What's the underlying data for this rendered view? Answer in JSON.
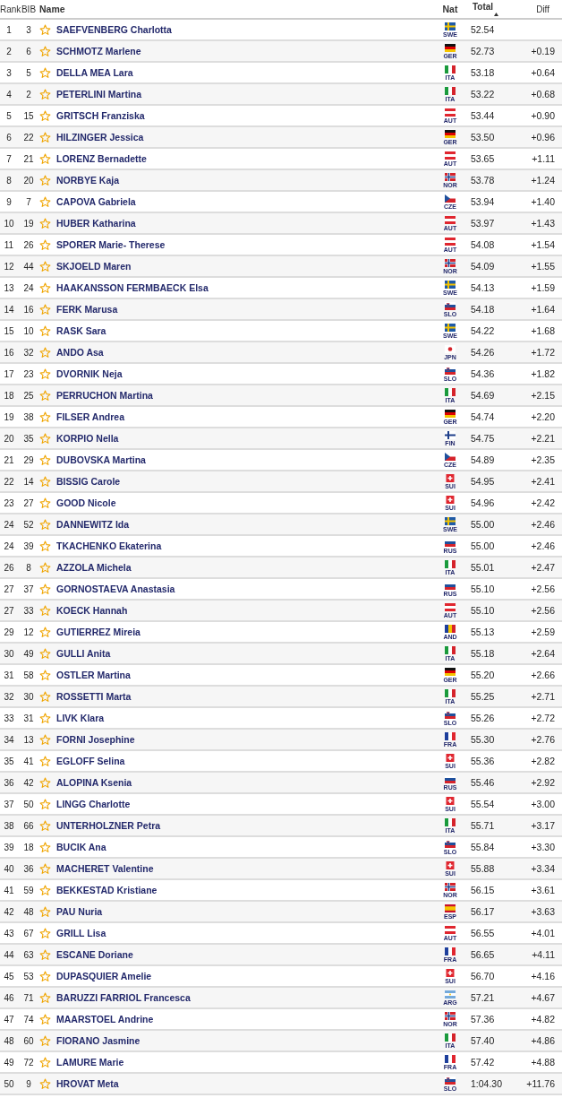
{
  "columns": {
    "rank": "Rank",
    "bib": "BIB",
    "name": "Name",
    "nat": "Nat",
    "total": "Total",
    "diff": "Diff"
  },
  "rows": [
    {
      "rank": "1",
      "bib": "3",
      "name": "SAEFVENBERG Charlotta",
      "kind": "swe",
      "nat": "SWE",
      "total": "52.54"
    },
    {
      "rank": "2",
      "bib": "6",
      "name": "SCHMOTZ Marlene",
      "kind": "ger",
      "nat": "GER",
      "total": "52.73",
      "diff": "+0.19"
    },
    {
      "rank": "3",
      "bib": "5",
      "name": "DELLA MEA Lara",
      "kind": "ita",
      "nat": "ITA",
      "total": "53.18",
      "diff": "+0.64"
    },
    {
      "rank": "4",
      "bib": "2",
      "name": "PETERLINI Martina",
      "kind": "ita",
      "nat": "ITA",
      "total": "53.22",
      "diff": "+0.68"
    },
    {
      "rank": "5",
      "bib": "15",
      "name": "GRITSCH Franziska",
      "kind": "aut",
      "nat": "AUT",
      "total": "53.44",
      "diff": "+0.90"
    },
    {
      "rank": "6",
      "bib": "22",
      "name": "HILZINGER Jessica",
      "kind": "ger",
      "nat": "GER",
      "total": "53.50",
      "diff": "+0.96"
    },
    {
      "rank": "7",
      "bib": "21",
      "name": "LORENZ Bernadette",
      "kind": "aut",
      "nat": "AUT",
      "total": "53.65",
      "diff": "+1.11"
    },
    {
      "rank": "8",
      "bib": "20",
      "name": "NORBYE Kaja",
      "kind": "nor",
      "nat": "NOR",
      "total": "53.78",
      "diff": "+1.24"
    },
    {
      "rank": "9",
      "bib": "7",
      "name": "CAPOVA Gabriela",
      "kind": "cze",
      "nat": "CZE",
      "total": "53.94",
      "diff": "+1.40"
    },
    {
      "rank": "10",
      "bib": "19",
      "name": "HUBER Katharina",
      "kind": "aut",
      "nat": "AUT",
      "total": "53.97",
      "diff": "+1.43"
    },
    {
      "rank": "11",
      "bib": "26",
      "name": "SPORER Marie- Therese",
      "kind": "aut",
      "nat": "AUT",
      "total": "54.08",
      "diff": "+1.54"
    },
    {
      "rank": "12",
      "bib": "44",
      "name": "SKJOELD Maren",
      "kind": "nor",
      "nat": "NOR",
      "total": "54.09",
      "diff": "+1.55"
    },
    {
      "rank": "13",
      "bib": "24",
      "name": "HAAKANSSON FERMBAECK Elsa",
      "kind": "swe",
      "nat": "SWE",
      "total": "54.13",
      "diff": "+1.59"
    },
    {
      "rank": "14",
      "bib": "16",
      "name": "FERK Marusa",
      "kind": "slo",
      "nat": "SLO",
      "total": "54.18",
      "diff": "+1.64"
    },
    {
      "rank": "15",
      "bib": "10",
      "name": "RASK Sara",
      "kind": "swe",
      "nat": "SWE",
      "total": "54.22",
      "diff": "+1.68"
    },
    {
      "rank": "16",
      "bib": "32",
      "name": "ANDO Asa",
      "kind": "jpn",
      "nat": "JPN",
      "total": "54.26",
      "diff": "+1.72"
    },
    {
      "rank": "17",
      "bib": "23",
      "name": "DVORNIK Neja",
      "kind": "slo",
      "nat": "SLO",
      "total": "54.36",
      "diff": "+1.82"
    },
    {
      "rank": "18",
      "bib": "25",
      "name": "PERRUCHON Martina",
      "kind": "ita",
      "nat": "ITA",
      "total": "54.69",
      "diff": "+2.15"
    },
    {
      "rank": "19",
      "bib": "38",
      "name": "FILSER Andrea",
      "kind": "ger",
      "nat": "GER",
      "total": "54.74",
      "diff": "+2.20"
    },
    {
      "rank": "20",
      "bib": "35",
      "name": "KORPIO Nella",
      "kind": "fin",
      "nat": "FIN",
      "total": "54.75",
      "diff": "+2.21"
    },
    {
      "rank": "21",
      "bib": "29",
      "name": "DUBOVSKA Martina",
      "kind": "cze",
      "nat": "CZE",
      "total": "54.89",
      "diff": "+2.35"
    },
    {
      "rank": "22",
      "bib": "14",
      "name": "BISSIG Carole",
      "kind": "sui",
      "nat": "SUI",
      "total": "54.95",
      "diff": "+2.41"
    },
    {
      "rank": "23",
      "bib": "27",
      "name": "GOOD Nicole",
      "kind": "sui",
      "nat": "SUI",
      "total": "54.96",
      "diff": "+2.42"
    },
    {
      "rank": "24",
      "bib": "52",
      "name": "DANNEWITZ Ida",
      "kind": "swe",
      "nat": "SWE",
      "total": "55.00",
      "diff": "+2.46"
    },
    {
      "rank": "24",
      "bib": "39",
      "name": "TKACHENKO Ekaterina",
      "kind": "rus",
      "nat": "RUS",
      "total": "55.00",
      "diff": "+2.46"
    },
    {
      "rank": "26",
      "bib": "8",
      "name": "AZZOLA Michela",
      "kind": "ita",
      "nat": "ITA",
      "total": "55.01",
      "diff": "+2.47"
    },
    {
      "rank": "27",
      "bib": "37",
      "name": "GORNOSTAEVA Anastasia",
      "kind": "rus",
      "nat": "RUS",
      "total": "55.10",
      "diff": "+2.56"
    },
    {
      "rank": "27",
      "bib": "33",
      "name": "KOECK Hannah",
      "kind": "aut",
      "nat": "AUT",
      "total": "55.10",
      "diff": "+2.56"
    },
    {
      "rank": "29",
      "bib": "12",
      "name": "GUTIERREZ Mireia",
      "kind": "and",
      "nat": "AND",
      "total": "55.13",
      "diff": "+2.59"
    },
    {
      "rank": "30",
      "bib": "49",
      "name": "GULLI Anita",
      "kind": "ita",
      "nat": "ITA",
      "total": "55.18",
      "diff": "+2.64"
    },
    {
      "rank": "31",
      "bib": "58",
      "name": "OSTLER Martina",
      "kind": "ger",
      "nat": "GER",
      "total": "55.20",
      "diff": "+2.66"
    },
    {
      "rank": "32",
      "bib": "30",
      "name": "ROSSETTI Marta",
      "kind": "ita",
      "nat": "ITA",
      "total": "55.25",
      "diff": "+2.71"
    },
    {
      "rank": "33",
      "bib": "31",
      "name": "LIVK Klara",
      "kind": "slo",
      "nat": "SLO",
      "total": "55.26",
      "diff": "+2.72"
    },
    {
      "rank": "34",
      "bib": "13",
      "name": "FORNI Josephine",
      "kind": "fra",
      "nat": "FRA",
      "total": "55.30",
      "diff": "+2.76"
    },
    {
      "rank": "35",
      "bib": "41",
      "name": "EGLOFF Selina",
      "kind": "sui",
      "nat": "SUI",
      "total": "55.36",
      "diff": "+2.82"
    },
    {
      "rank": "36",
      "bib": "42",
      "name": "ALOPINA Ksenia",
      "kind": "rus",
      "nat": "RUS",
      "total": "55.46",
      "diff": "+2.92"
    },
    {
      "rank": "37",
      "bib": "50",
      "name": "LINGG Charlotte",
      "kind": "sui",
      "nat": "SUI",
      "total": "55.54",
      "diff": "+3.00"
    },
    {
      "rank": "38",
      "bib": "66",
      "name": "UNTERHOLZNER Petra",
      "kind": "ita",
      "nat": "ITA",
      "total": "55.71",
      "diff": "+3.17"
    },
    {
      "rank": "39",
      "bib": "18",
      "name": "BUCIK Ana",
      "kind": "slo",
      "nat": "SLO",
      "total": "55.84",
      "diff": "+3.30"
    },
    {
      "rank": "40",
      "bib": "36",
      "name": "MACHERET Valentine",
      "kind": "sui",
      "nat": "SUI",
      "total": "55.88",
      "diff": "+3.34"
    },
    {
      "rank": "41",
      "bib": "59",
      "name": "BEKKESTAD Kristiane",
      "kind": "nor",
      "nat": "NOR",
      "total": "56.15",
      "diff": "+3.61"
    },
    {
      "rank": "42",
      "bib": "48",
      "name": "PAU Nuria",
      "kind": "esp",
      "nat": "ESP",
      "total": "56.17",
      "diff": "+3.63"
    },
    {
      "rank": "43",
      "bib": "67",
      "name": "GRILL Lisa",
      "kind": "aut",
      "nat": "AUT",
      "total": "56.55",
      "diff": "+4.01"
    },
    {
      "rank": "44",
      "bib": "63",
      "name": "ESCANE Doriane",
      "kind": "fra",
      "nat": "FRA",
      "total": "56.65",
      "diff": "+4.11"
    },
    {
      "rank": "45",
      "bib": "53",
      "name": "DUPASQUIER Amelie",
      "kind": "sui",
      "nat": "SUI",
      "total": "56.70",
      "diff": "+4.16"
    },
    {
      "rank": "46",
      "bib": "71",
      "name": "BARUZZI FARRIOL Francesca",
      "kind": "arg",
      "nat": "ARG",
      "total": "57.21",
      "diff": "+4.67"
    },
    {
      "rank": "47",
      "bib": "74",
      "name": "MAARSTOEL Andrine",
      "kind": "nor",
      "nat": "NOR",
      "total": "57.36",
      "diff": "+4.82"
    },
    {
      "rank": "48",
      "bib": "60",
      "name": "FIORANO Jasmine",
      "kind": "ita",
      "nat": "ITA",
      "total": "57.40",
      "diff": "+4.86"
    },
    {
      "rank": "49",
      "bib": "72",
      "name": "LAMURE Marie",
      "kind": "fra",
      "nat": "FRA",
      "total": "57.42",
      "diff": "+4.88"
    },
    {
      "rank": "50",
      "bib": "9",
      "name": "HROVAT Meta",
      "kind": "slo",
      "nat": "SLO",
      "total": "1:04.30",
      "diff": "+11.76"
    }
  ]
}
